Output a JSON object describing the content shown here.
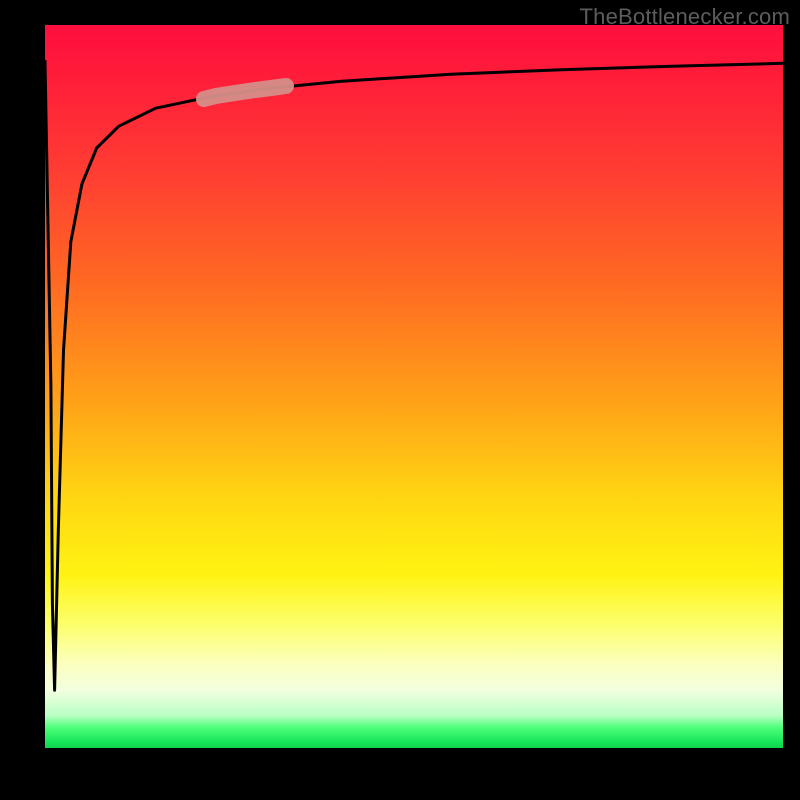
{
  "watermark": "TheBottlenecker.com",
  "colors": {
    "frame": "#000000",
    "curve": "#000000",
    "highlight": "#d68e88",
    "watermark_text": "#5d5d5d"
  },
  "chart_data": {
    "type": "line",
    "title": "",
    "xlabel": "",
    "ylabel": "",
    "xlim": [
      0,
      100
    ],
    "ylim": [
      0,
      100
    ],
    "grid": false,
    "series": [
      {
        "name": "bottleneck-curve",
        "x": [
          0,
          0.8,
          1.0,
          1.3,
          1.8,
          2.5,
          3.5,
          5,
          7,
          10,
          15,
          22,
          30,
          40,
          55,
          70,
          85,
          100
        ],
        "y": [
          95,
          50,
          20,
          8,
          30,
          55,
          70,
          78,
          83,
          86,
          88.5,
          90,
          91.2,
          92.2,
          93.2,
          93.8,
          94.3,
          94.7
        ]
      }
    ],
    "annotations": [
      {
        "name": "highlight-segment",
        "x_range": [
          22,
          32
        ],
        "style": "thick-rose-stroke"
      }
    ],
    "background_gradient_stops": [
      {
        "pos": 0.0,
        "color": "#ff0e3e"
      },
      {
        "pos": 0.36,
        "color": "#ff6a22"
      },
      {
        "pos": 0.66,
        "color": "#ffd812"
      },
      {
        "pos": 0.88,
        "color": "#fbffc0"
      },
      {
        "pos": 0.97,
        "color": "#4dff7a"
      },
      {
        "pos": 1.0,
        "color": "#0fd24e"
      }
    ]
  }
}
